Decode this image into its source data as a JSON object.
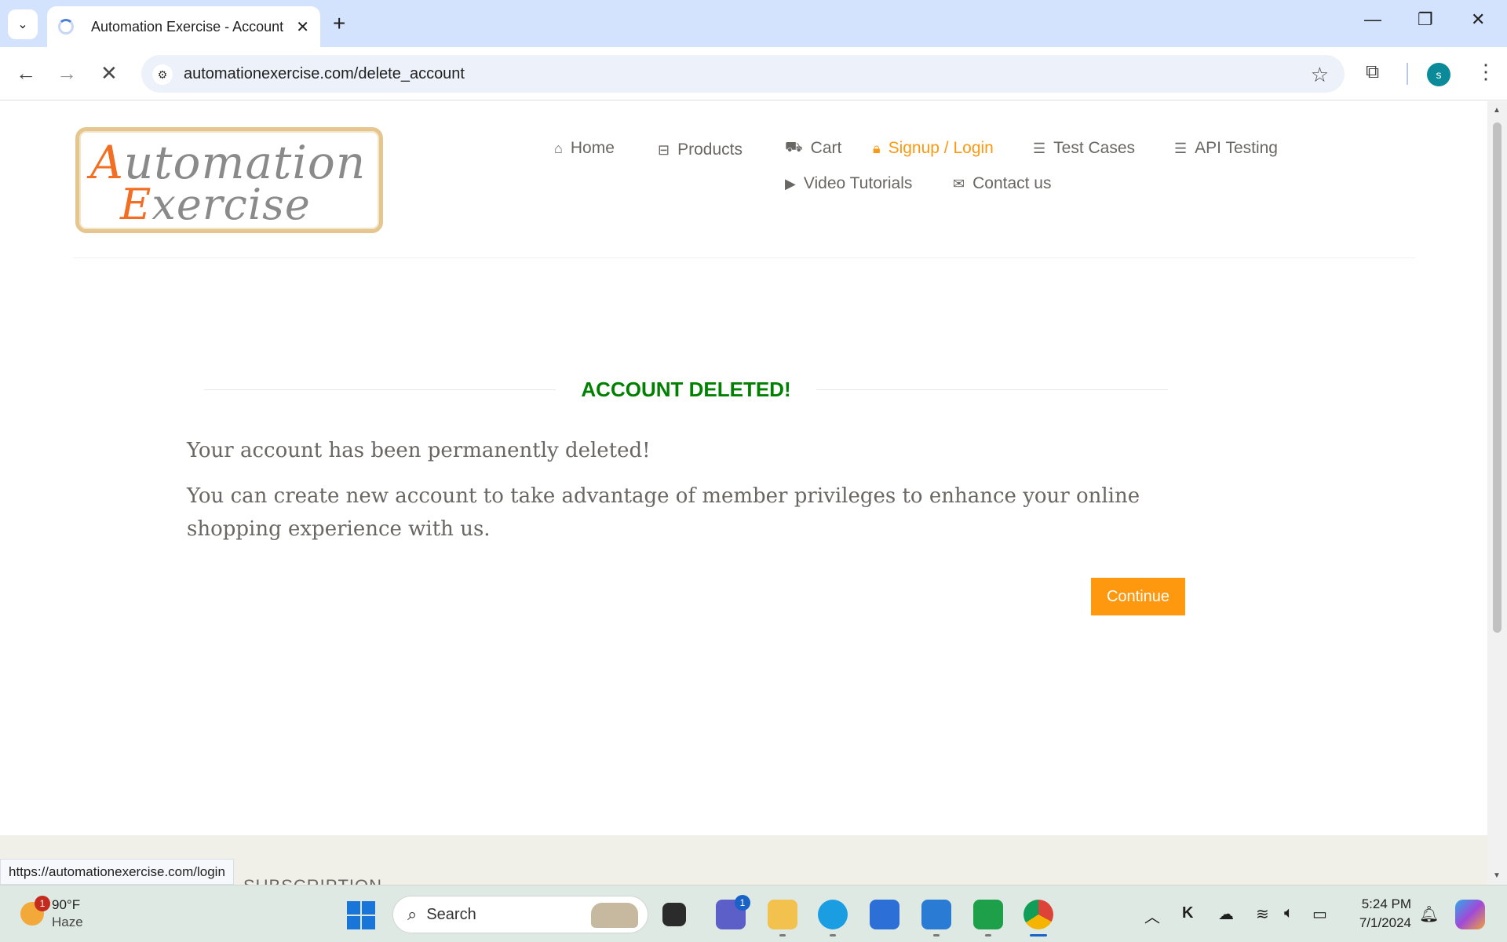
{
  "browser": {
    "tab_title": "Automation Exercise - Account",
    "url": "automationexercise.com/delete_account",
    "profile_initial": "s"
  },
  "logo": {
    "line1_cap": "A",
    "line1_rest": "utomation",
    "line2_cap": "E",
    "line2_rest": "xercise"
  },
  "nav": {
    "items": [
      {
        "label": "Home",
        "icon": "home-icon"
      },
      {
        "label": "Products",
        "icon": "briefcase-icon"
      },
      {
        "label": "Cart",
        "icon": "cart-icon"
      },
      {
        "label": "Signup / Login",
        "icon": "lock-icon",
        "active": true
      },
      {
        "label": "Test Cases",
        "icon": "list-icon"
      },
      {
        "label": "API Testing",
        "icon": "list-icon"
      },
      {
        "label": "Video Tutorials",
        "icon": "youtube-play-icon"
      },
      {
        "label": "Contact us",
        "icon": "envelope-icon"
      }
    ]
  },
  "main": {
    "title": "ACCOUNT DELETED!",
    "message1": "Your account has been permanently deleted!",
    "message2": "You can create new account to take advantage of member privileges to enhance your online shopping experience with us.",
    "continue_label": "Continue"
  },
  "footer": {
    "subscription_partial": "SUBSCRIPTION"
  },
  "status_bar": {
    "hover_url": "https://automationexercise.com/login"
  },
  "taskbar": {
    "weather_temp": "90°F",
    "weather_condition": "Haze",
    "weather_badge": "1",
    "search_label": "Search",
    "teams_badge": "1",
    "time": "5:24 PM",
    "date": "7/1/2024"
  },
  "colors": {
    "accent": "#fe980f",
    "title_green": "#008000",
    "nav_text": "#696763"
  }
}
